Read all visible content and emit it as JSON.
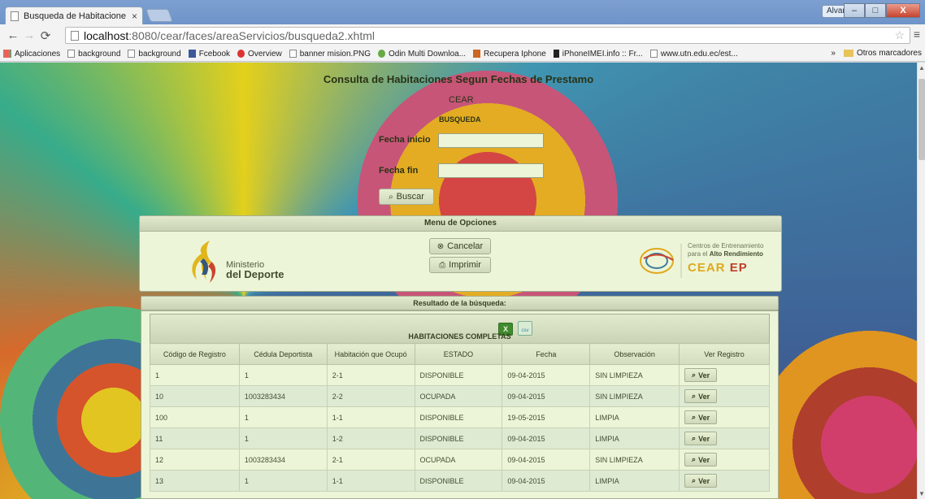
{
  "browser": {
    "tab_title": "Busqueda de Habitacione",
    "tab_close": "×",
    "user_badge": "Alvaro",
    "win_minimize": "–",
    "win_maximize": "□",
    "win_close": "X",
    "url_host": "localhost",
    "url_path": ":8080/cear/faces/areaServicios/busqueda2.xhtml",
    "bookmarks": [
      {
        "label": "Aplicaciones",
        "icon": "apps-grid-icon"
      },
      {
        "label": "background",
        "icon": "page-icon"
      },
      {
        "label": "background",
        "icon": "page-icon"
      },
      {
        "label": "Fcebook",
        "icon": "facebook-icon"
      },
      {
        "label": "Overview",
        "icon": "overview-icon"
      },
      {
        "label": "banner mision.PNG",
        "icon": "page-icon"
      },
      {
        "label": "Odin Multi Downloa...",
        "icon": "odin-icon"
      },
      {
        "label": "Recupera Iphone",
        "icon": "recupera-icon"
      },
      {
        "label": "iPhoneIMEI.info :: Fr...",
        "icon": "phone-icon"
      },
      {
        "label": "www.utn.edu.ec/est...",
        "icon": "page-icon"
      }
    ],
    "bookmarks_overflow": "»",
    "other_bookmarks": "Otros marcadores"
  },
  "page": {
    "heading": "Consulta de Habitaciones Segun Fechas de Prestamo",
    "org": "CEAR",
    "section": "BUSQUEDA",
    "fecha_inicio_label": "Fecha inicio",
    "fecha_inicio_value": "",
    "fecha_fin_label": "Fecha fin",
    "fecha_fin_value": "",
    "search_button": "Buscar"
  },
  "menu": {
    "title": "Menu de Opciones",
    "cancel_button": "Cancelar",
    "print_button": "Imprimir",
    "ministerio_line1": "Ministerio",
    "ministerio_line2": "del Deporte",
    "cear_tagline1": "Centros de Entrenamiento",
    "cear_tagline2_prefix": "para el",
    "cear_tagline2_bold": "Alto Rendimiento",
    "cear_brand": "CEAR",
    "cear_brand_suffix": "EP"
  },
  "results": {
    "header": "Resultado de la búsqueda:",
    "caption": "HABITACIONES COMPLETAS",
    "csv_label": "csv",
    "excel_label": "X",
    "columns": [
      "Código de Registro",
      "Cédula Deportista",
      "Habitación que Ocupó",
      "ESTADO",
      "Fecha",
      "Observación",
      "Ver Registro"
    ],
    "view_button": "Ver",
    "rows": [
      {
        "codigo": "1",
        "cedula": "1",
        "habitacion": "2-1",
        "estado": "DISPONIBLE",
        "fecha": "09-04-2015",
        "observacion": "SIN LIMPIEZA"
      },
      {
        "codigo": "10",
        "cedula": "1003283434",
        "habitacion": "2-2",
        "estado": "OCUPADA",
        "fecha": "09-04-2015",
        "observacion": "SIN LIMPIEZA"
      },
      {
        "codigo": "100",
        "cedula": "1",
        "habitacion": "1-1",
        "estado": "DISPONIBLE",
        "fecha": "19-05-2015",
        "observacion": "LIMPIA"
      },
      {
        "codigo": "11",
        "cedula": "1",
        "habitacion": "1-2",
        "estado": "DISPONIBLE",
        "fecha": "09-04-2015",
        "observacion": "LIMPIA"
      },
      {
        "codigo": "12",
        "cedula": "1003283434",
        "habitacion": "2-1",
        "estado": "OCUPADA",
        "fecha": "09-04-2015",
        "observacion": "SIN LIMPIEZA"
      },
      {
        "codigo": "13",
        "cedula": "1",
        "habitacion": "1-1",
        "estado": "DISPONIBLE",
        "fecha": "09-04-2015",
        "observacion": "LIMPIA"
      }
    ]
  }
}
